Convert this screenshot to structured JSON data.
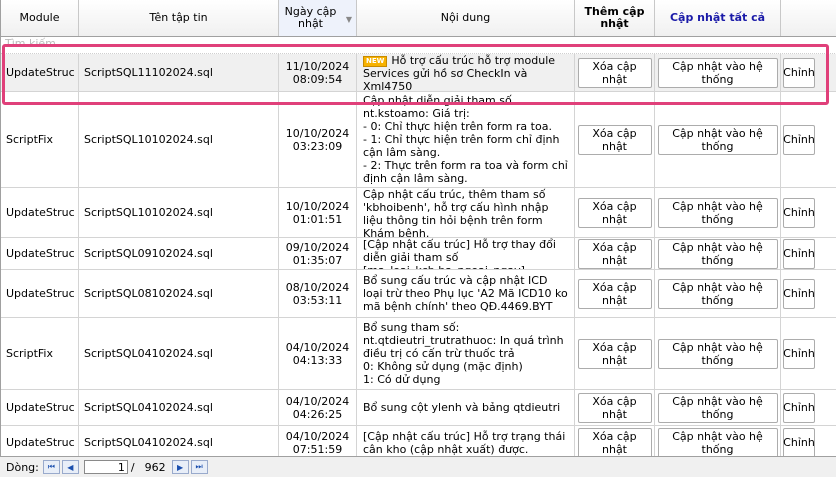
{
  "headers": {
    "module": "Module",
    "file": "Tên tập tin",
    "date": "Ngày cập nhật",
    "desc": "Nội dung",
    "add": "Thêm cập nhật",
    "update_all": "Cập nhật tất cả"
  },
  "filter_placeholder": "Tìm kiếm",
  "new_badge": "NEW",
  "rows": [
    {
      "module": "UpdateStruc",
      "file": "ScriptSQL11102024.sql",
      "date": "11/10/2024",
      "time": "08:09:54",
      "desc": "Hỗ trợ cấu trúc hỗ trợ module Services gửi hồ sơ CheckIn và Xml4750",
      "b1": "Xóa cập nhật",
      "b2": "Cập nhật vào hệ thống",
      "b3": "Chỉnh"
    },
    {
      "module": "ScriptFix",
      "file": "ScriptSQL10102024.sql",
      "date": "10/10/2024",
      "time": "03:23:09",
      "desc": "Cập nhật diễn giải tham số nt.kstoamo: Giá trị:\n - 0: Chỉ thực hiện trên form ra toa.\n - 1: Chỉ thực hiện trên form chỉ định cận lâm sàng.\n - 2: Thực trên form ra toa và form chỉ định cận lâm sàng.",
      "b1": "Xóa cập nhật",
      "b2": "Cập nhật vào hệ thống",
      "b3": "Chỉnh"
    },
    {
      "module": "UpdateStruc",
      "file": "ScriptSQL10102024.sql",
      "date": "10/10/2024",
      "time": "01:01:51",
      "desc": "Cập nhật cấu trúc, thêm tham số 'kbhoibenh', hỗ trợ cấu hình nhập liệu thông tin hỏi bệnh trên form Khám bệnh.",
      "b1": "Xóa cập nhật",
      "b2": "Cập nhật vào hệ thống",
      "b3": "Chỉnh"
    },
    {
      "module": "UpdateStruc",
      "file": "ScriptSQL09102024.sql",
      "date": "09/10/2024",
      "time": "01:35:07",
      "desc": "[Cập nhật cấu trúc] Hỗ trợ thay đổi diễn giải tham số [ma_loai_kcb.ba_ngoai_ngay]",
      "b1": "Xóa cập nhật",
      "b2": "Cập nhật vào hệ thống",
      "b3": "Chỉnh"
    },
    {
      "module": "UpdateStruc",
      "file": "ScriptSQL08102024.sql",
      "date": "08/10/2024",
      "time": "03:53:11",
      "desc": "Bổ sung cấu trúc và cập nhật ICD loại trừ theo Phụ lục 'A2 Mã ICD10 ko mã bệnh chính' theo QĐ.4469.BYT",
      "b1": "Xóa cập nhật",
      "b2": "Cập nhật vào hệ thống",
      "b3": "Chỉnh"
    },
    {
      "module": "ScriptFix",
      "file": "ScriptSQL04102024.sql",
      "date": "04/10/2024",
      "time": "04:13:33",
      "desc": "Bổ sung tham số:\nnt.qtdieutri_trutrathuoc: In quá trình điều trị có cấn trừ thuốc trả\n 0: Không sử dụng (mặc định)\n 1: Có dử dụng",
      "b1": "Xóa cập nhật",
      "b2": "Cập nhật vào hệ thống",
      "b3": "Chỉnh"
    },
    {
      "module": "UpdateStruc",
      "file": "ScriptSQL04102024.sql",
      "date": "04/10/2024",
      "time": "04:26:25",
      "desc": "Bổ sung cột ylenh và bảng qtdieutri",
      "b1": "Xóa cập nhật",
      "b2": "Cập nhật vào hệ thống",
      "b3": "Chỉnh"
    },
    {
      "module": "UpdateStruc",
      "file": "ScriptSQL04102024.sql",
      "date": "04/10/2024",
      "time": "07:51:59",
      "desc": "[Cập nhật cấu trúc] Hỗ trợ trạng thái cân kho (cập nhật xuất) được.",
      "b1": "Xóa cập nhật",
      "b2": "Cập nhật vào hệ thống",
      "b3": "Chỉnh"
    }
  ],
  "footer": {
    "label": "Dòng:",
    "first": "⏮",
    "prev": "◀",
    "current": "1",
    "sep": "/",
    "total": "962",
    "next": "▶",
    "last": "⏭"
  }
}
